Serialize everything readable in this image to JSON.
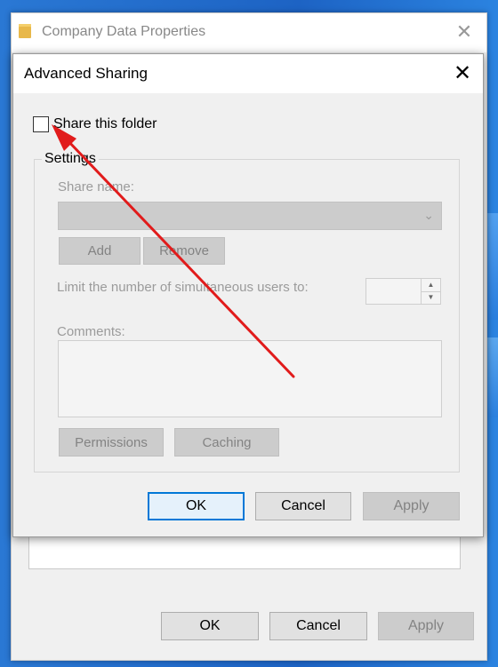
{
  "props_window": {
    "title": "Company Data Properties",
    "close_icon": "✕",
    "buttons": {
      "ok": "OK",
      "cancel": "Cancel",
      "apply": "Apply"
    }
  },
  "advanced_sharing": {
    "title": "Advanced Sharing",
    "close_icon": "✕",
    "share_checkbox": {
      "label": "Share this folder",
      "checked": false
    },
    "settings": {
      "legend": "Settings",
      "share_name_label": "Share name:",
      "share_name_value": "",
      "add_label": "Add",
      "remove_label": "Remove",
      "limit_label": "Limit the number of simultaneous users to:",
      "limit_value": "",
      "comments_label": "Comments:",
      "comments_value": "",
      "permissions_label": "Permissions",
      "caching_label": "Caching"
    },
    "buttons": {
      "ok": "OK",
      "cancel": "Cancel",
      "apply": "Apply"
    }
  },
  "colors": {
    "annotation_arrow": "#e11b1b",
    "focus_border": "#0078d7",
    "desktop_blue": "#1f6fd0"
  }
}
